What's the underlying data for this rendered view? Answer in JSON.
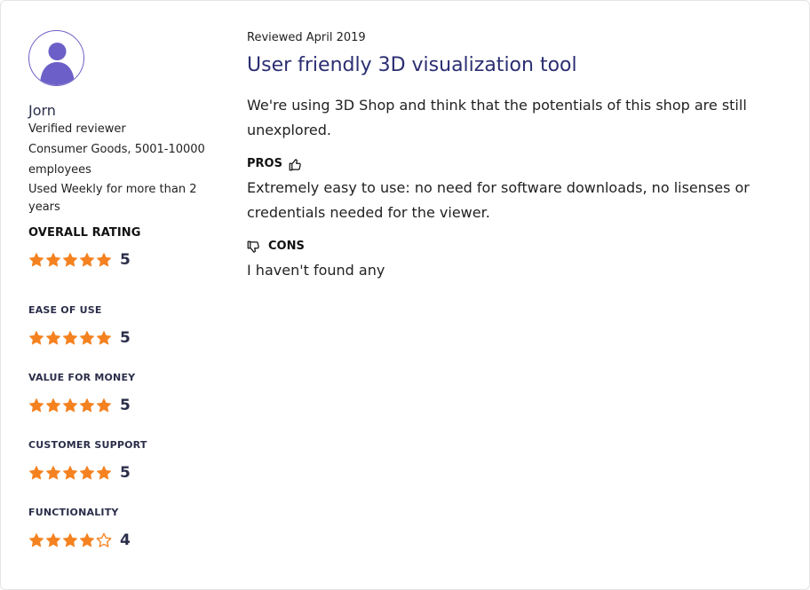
{
  "reviewer": {
    "name": "Jorn",
    "verified": "Verified reviewer",
    "company": "Consumer Goods, 5001-10000 employees",
    "usage": "Used Weekly for more than 2 years"
  },
  "ratings": {
    "overall": {
      "label": "OVERALL RATING",
      "value": 5,
      "max": 5,
      "display": "5"
    },
    "categories": [
      {
        "label": "EASE OF USE",
        "value": 5,
        "display": "5"
      },
      {
        "label": "VALUE FOR MONEY",
        "value": 5,
        "display": "5"
      },
      {
        "label": "CUSTOMER SUPPORT",
        "value": 5,
        "display": "5"
      },
      {
        "label": "FUNCTIONALITY",
        "value": 4,
        "display": "4"
      }
    ]
  },
  "review": {
    "date": "Reviewed April 2019",
    "title": "User friendly 3D visualization tool",
    "body": "We're using 3D Shop and think that the potentials of this shop are still unexplored.",
    "pros_label": "PROS",
    "pros": "Extremely easy to use: no need for software downloads, no lisenses or credentials needed for the viewer.",
    "cons_label": "CONS",
    "cons": "I haven't found any"
  },
  "colors": {
    "star_fill": "#f58220",
    "avatar_accent": "#6c5fc7",
    "title": "#2b2e72"
  },
  "icons": {
    "avatar": "user-silhouette-icon",
    "pros": "thumbs-up-icon",
    "cons": "thumbs-down-icon",
    "rating": "star-icon"
  }
}
